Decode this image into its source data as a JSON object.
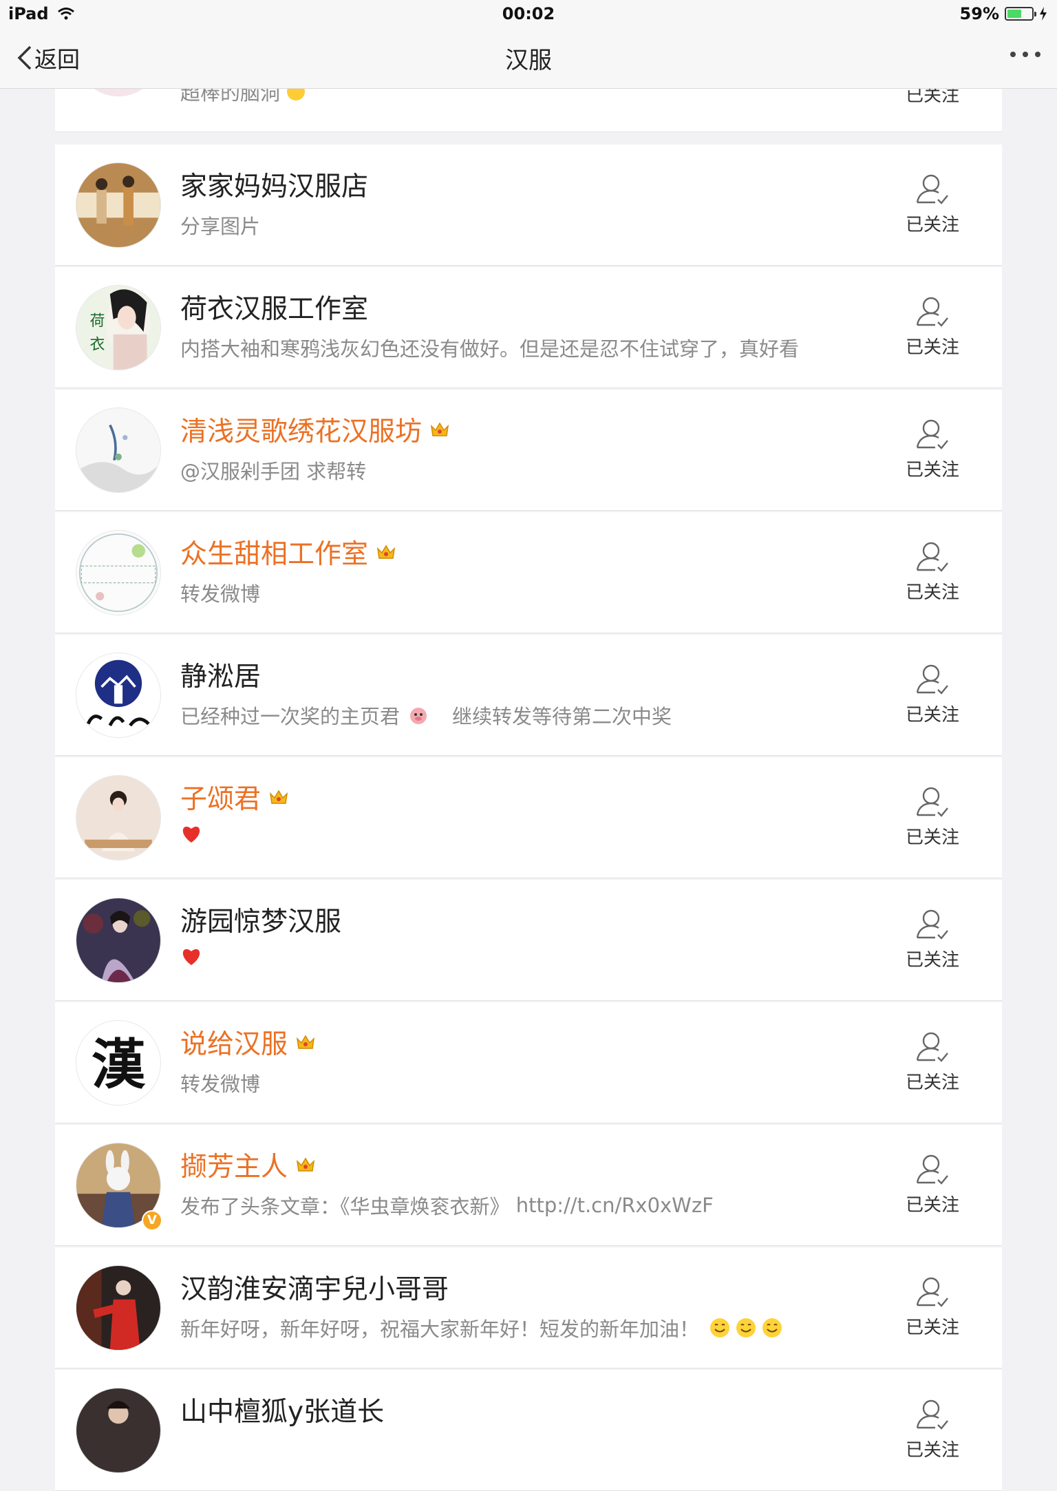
{
  "status": {
    "device": "iPad",
    "time": "00:02",
    "battery": "59%",
    "battery_level": 0.59
  },
  "nav": {
    "back": "返回",
    "title": "汉服"
  },
  "colors": {
    "vip_name": "#eb7124",
    "desc": "#8a8a8a",
    "badge": "#f5a623",
    "heart": "#e8302a"
  },
  "partial_top": {
    "desc": "超棒的脑洞",
    "follow": "已关注"
  },
  "items": [
    {
      "name": "家家妈妈汉服店",
      "desc": "分享图片",
      "vip": false,
      "follow": "已关注"
    },
    {
      "name": "荷衣汉服工作室",
      "desc": "内搭大袖和寒鸦浅灰幻色还没有做好。但是还是忍不住试穿了，真好看",
      "vip": false,
      "follow": "已关注"
    },
    {
      "name": "清浅灵歌绣花汉服坊",
      "desc": "@汉服剁手团 求帮转",
      "vip": true,
      "follow": "已关注"
    },
    {
      "name": "众生甜相工作室",
      "desc": "转发微博",
      "vip": true,
      "follow": "已关注"
    },
    {
      "name": "静淞居",
      "desc": "已经种过一次奖的主页君",
      "desc2": "继续转发等待第二次中奖",
      "vip": false,
      "follow": "已关注"
    },
    {
      "name": "子颂君",
      "desc": "",
      "desc_icon": "heart-emoji",
      "vip": true,
      "follow": "已关注"
    },
    {
      "name": "游园惊梦汉服",
      "desc": "",
      "desc_icon": "heart-emoji",
      "vip": false,
      "follow": "已关注"
    },
    {
      "name": "说给汉服",
      "desc": "转发微博",
      "vip": true,
      "follow": "已关注"
    },
    {
      "name": "撷芳主人",
      "desc": "发布了头条文章：《华虫章焕衮衣新》",
      "link": "http://t.cn/Rx0xWzF",
      "vip": true,
      "verified": true,
      "badge": "V",
      "follow": "已关注"
    },
    {
      "name": "汉韵淮安滴宇兒小哥哥",
      "desc": "新年好呀，新年好呀，祝福大家新年好！短发的新年加油！",
      "desc_icon": "smile-emoji",
      "vip": false,
      "follow": "已关注"
    },
    {
      "name": "山中檀狐y张道长",
      "desc": "",
      "vip": false,
      "follow": "已关注"
    }
  ]
}
